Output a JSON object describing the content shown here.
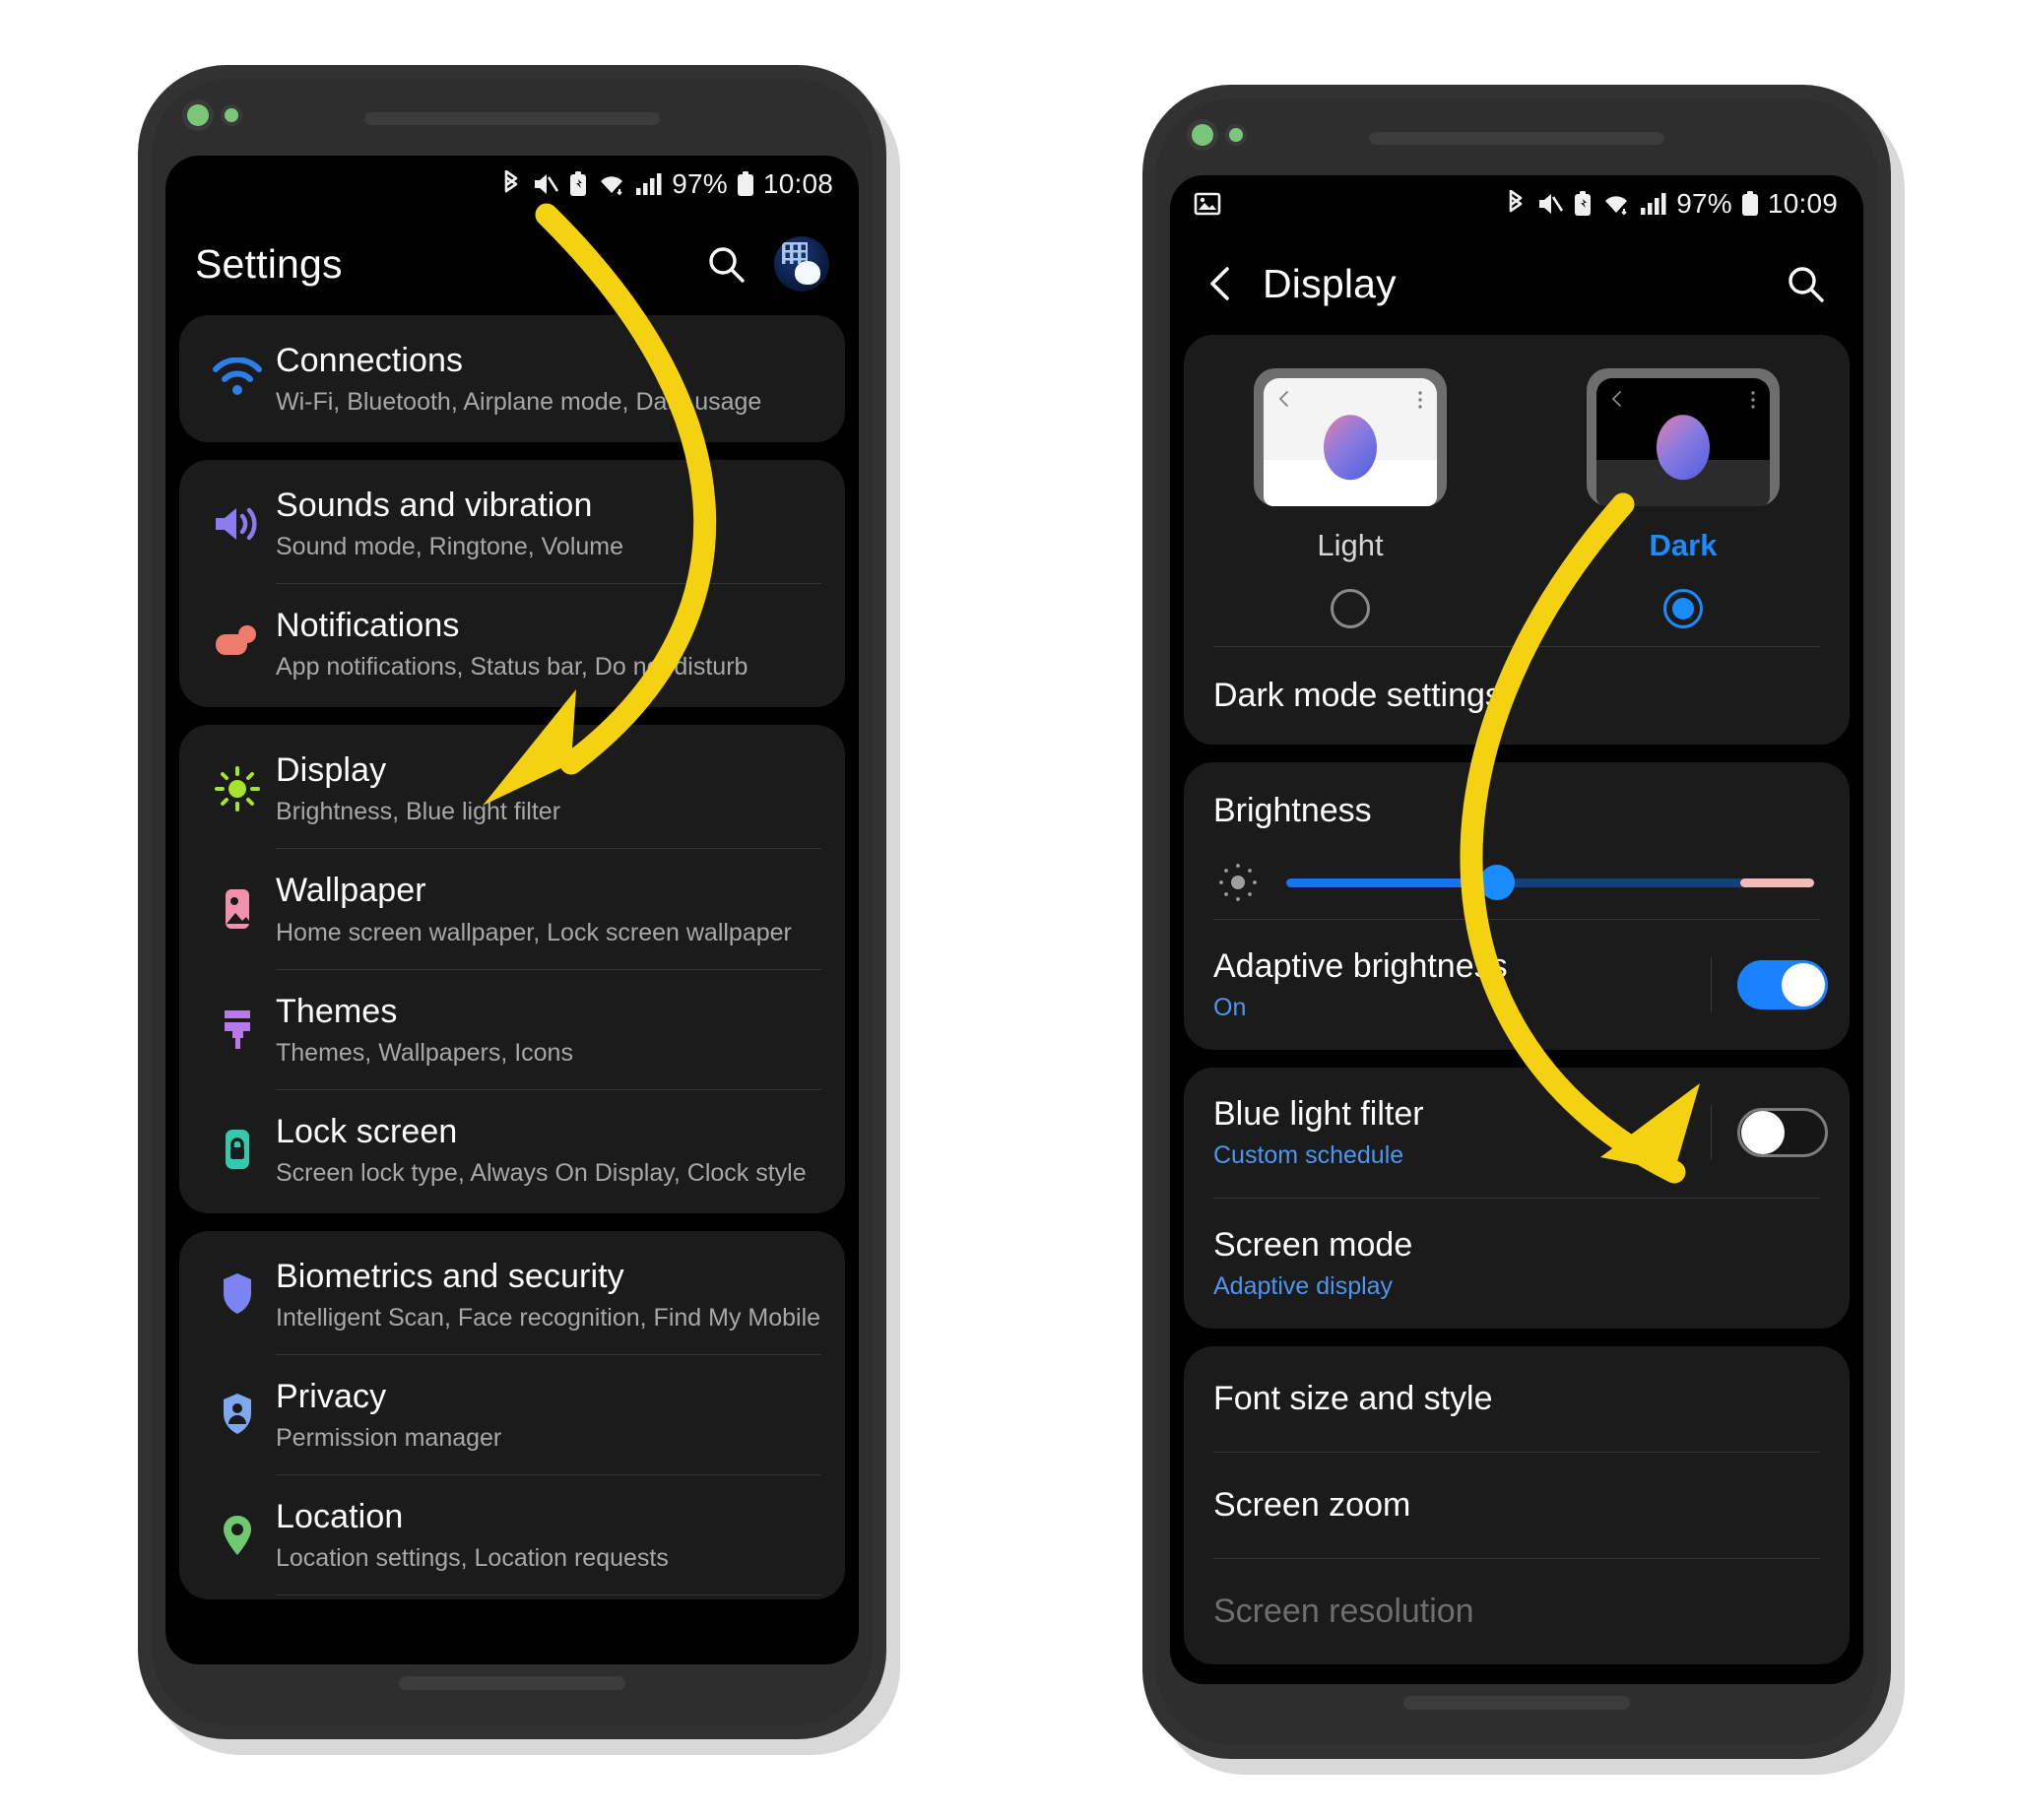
{
  "phones": {
    "left": {
      "status_bar": {
        "icons": [
          "bluetooth-icon",
          "mute-icon",
          "battery-saver-icon",
          "wifi-icon",
          "signal-icon"
        ],
        "battery_percent": "97%",
        "time": "10:08"
      },
      "app_bar": {
        "title": "Settings",
        "search_label": "search-icon",
        "avatar_label": "profile-avatar"
      },
      "groups": [
        {
          "items": [
            {
              "title": "Connections",
              "subtitle": "Wi-Fi, Bluetooth, Airplane mode, Data usage",
              "icon": "wifi-icon",
              "color": "#2a7fe8"
            }
          ]
        },
        {
          "items": [
            {
              "title": "Sounds and vibration",
              "subtitle": "Sound mode, Ringtone, Volume",
              "icon": "volume-icon",
              "color": "#8a7bf0"
            },
            {
              "title": "Notifications",
              "subtitle": "App notifications, Status bar, Do not disturb",
              "icon": "notification-bubble-icon",
              "color": "#ef7a6e"
            }
          ]
        },
        {
          "items": [
            {
              "title": "Display",
              "subtitle": "Brightness, Blue light filter",
              "icon": "brightness-sun-icon",
              "color": "#a6e22e"
            },
            {
              "title": "Wallpaper",
              "subtitle": "Home screen wallpaper, Lock screen wallpaper",
              "icon": "wallpaper-image-icon",
              "color": "#f091ad"
            },
            {
              "title": "Themes",
              "subtitle": "Themes, Wallpapers, Icons",
              "icon": "paintbrush-icon",
              "color": "#b87ae8"
            },
            {
              "title": "Lock screen",
              "subtitle": "Screen lock type, Always On Display, Clock style",
              "icon": "lock-icon",
              "color": "#35c9ab"
            }
          ]
        },
        {
          "items": [
            {
              "title": "Biometrics and security",
              "subtitle": "Intelligent Scan, Face recognition, Find My Mobile",
              "icon": "shield-icon",
              "color": "#7b84f0"
            },
            {
              "title": "Privacy",
              "subtitle": "Permission manager",
              "icon": "shield-person-icon",
              "color": "#7fa8ee"
            },
            {
              "title": "Location",
              "subtitle": "Location settings, Location requests",
              "icon": "location-pin-icon",
              "color": "#6fc96f"
            }
          ]
        }
      ]
    },
    "right": {
      "status_bar": {
        "left_icons": [
          "image-icon"
        ],
        "icons": [
          "bluetooth-icon",
          "mute-icon",
          "battery-saver-icon",
          "wifi-icon",
          "signal-icon"
        ],
        "battery_percent": "97%",
        "time": "10:09"
      },
      "app_bar": {
        "back_label": "back-chevron-icon",
        "title": "Display",
        "search_label": "search-icon"
      },
      "theme_picker": {
        "options": [
          {
            "label": "Light",
            "selected": false
          },
          {
            "label": "Dark",
            "selected": true
          }
        ],
        "selected_color": "#1a8cff",
        "dark_mode_settings_label": "Dark mode settings"
      },
      "brightness": {
        "title": "Brightness",
        "icon": "brightness-low-icon",
        "value_percent": 40,
        "warm_zone_start_percent": 86,
        "fill_color": "#1a73e8",
        "track_color": "#12407a",
        "warm_color": "#f3bbb8"
      },
      "toggles": [
        {
          "title": "Adaptive brightness",
          "subtitle": "On",
          "state": "on"
        },
        {
          "title": "Blue light filter",
          "subtitle": "Custom schedule",
          "state": "off"
        }
      ],
      "screen_mode": {
        "title": "Screen mode",
        "subtitle": "Adaptive display"
      },
      "plain_rows": [
        {
          "title": "Font size and style",
          "dim": false
        },
        {
          "title": "Screen zoom",
          "dim": false
        },
        {
          "title": "Screen resolution",
          "dim": true
        }
      ]
    }
  },
  "annotations": {
    "arrow_color": "#f5d211",
    "arrows": [
      {
        "name": "arrow-to-display",
        "from": "settings-header",
        "to": "display-row"
      },
      {
        "name": "arrow-to-blue-light-filter",
        "from": "dark-theme-option",
        "to": "blue-light-filter-toggle"
      }
    ]
  }
}
